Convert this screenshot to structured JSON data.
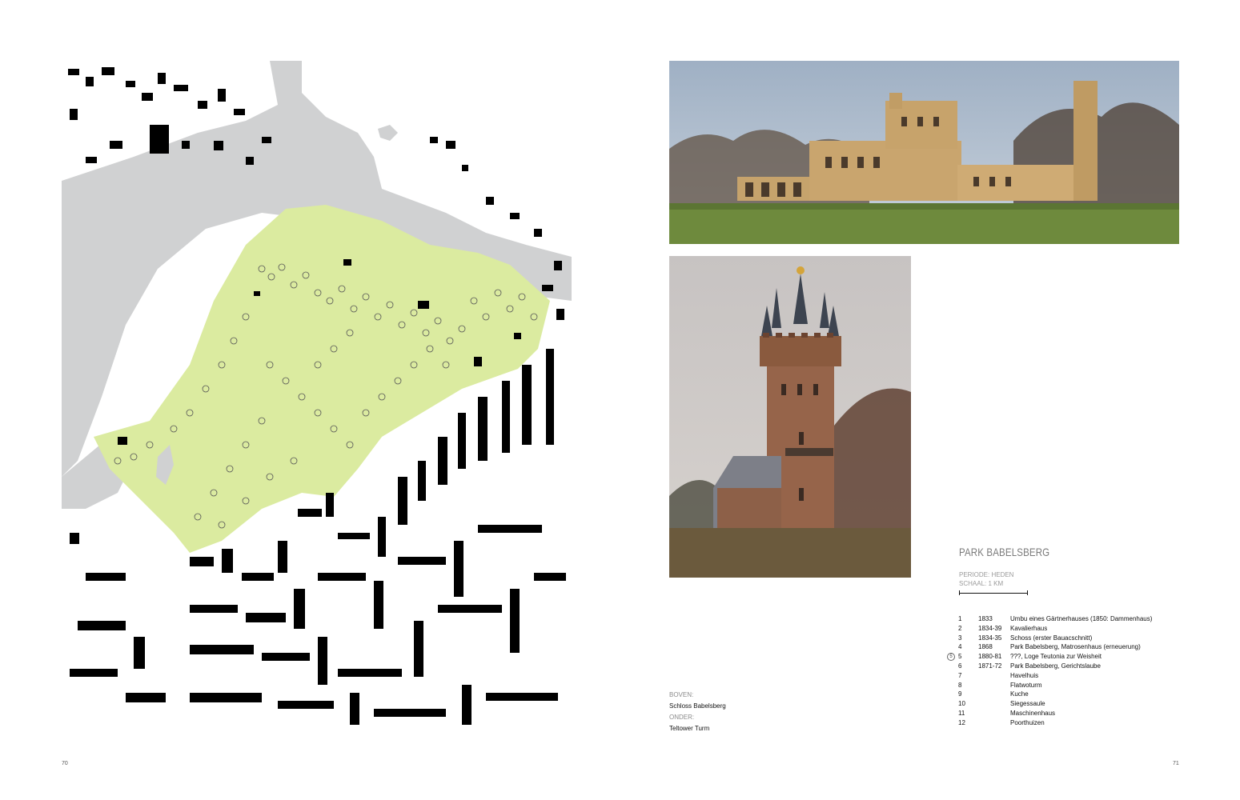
{
  "colors": {
    "park": "#dbeba0",
    "water": "#d0d1d2",
    "buildings": "#000000"
  },
  "map": {
    "description_icon": "figure-ground-map"
  },
  "photos": {
    "top_icon": "castle-photo",
    "bottom_icon": "tower-photo"
  },
  "caption": {
    "top_head": "BOVEN:",
    "top_text": "Schloss Babelsberg",
    "bottom_head": "ONDER:",
    "bottom_text": "Teltower Turm"
  },
  "title": "PARK BABELSBERG",
  "meta": {
    "period": "PERIODE: HEDEN",
    "scale": "SCHAAL: 1 KM"
  },
  "legend": [
    {
      "num": "1",
      "year": "1833",
      "name": "Umbu eines Gärtnerhauses (1850: Dammenhaus)"
    },
    {
      "num": "2",
      "year": "1834-39",
      "name": "Kavalierhaus"
    },
    {
      "num": "3",
      "year": "1834-35",
      "name": "Schoss (erster Bauacschnitt)"
    },
    {
      "num": "4",
      "year": "1868",
      "name": "Park Babelsberg, Matrosenhaus (erneuerung)"
    },
    {
      "num": "5",
      "year": "1880-81",
      "name": "???, Loge Teutonia zur Weisheit",
      "mark": "5"
    },
    {
      "num": "6",
      "year": "1871-72",
      "name": "Park Babelsberg, Gerichtslaube"
    },
    {
      "num": "7",
      "year": "",
      "name": "Havelhuis"
    },
    {
      "num": "8",
      "year": "",
      "name": "Flatwoturm"
    },
    {
      "num": "9",
      "year": "",
      "name": "Kuche"
    },
    {
      "num": "10",
      "year": "",
      "name": "Siegessaule"
    },
    {
      "num": "11",
      "year": "",
      "name": "Maschinenhaus"
    },
    {
      "num": "12",
      "year": "",
      "name": "Poorthuizen"
    }
  ],
  "page_numbers": {
    "left": "70",
    "right": "71"
  }
}
